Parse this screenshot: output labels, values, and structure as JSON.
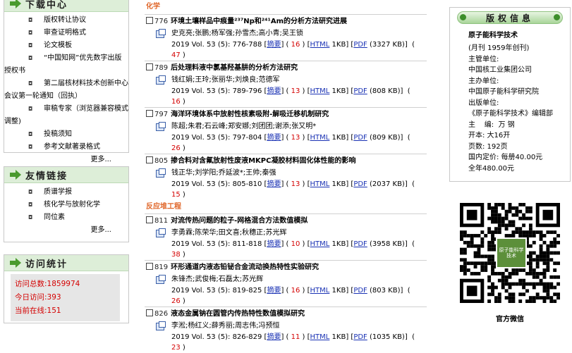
{
  "download_center": {
    "title": "下载中心",
    "items": [
      "版权转让协议",
      "审查证明格式",
      "论文模板",
      "“中国知网”优先数字出版授权书",
      "第二届核材料技术创新中心会议第一轮通知（回执）",
      "审稿专家（浏览器兼容模式调整)",
      "投稿须知",
      "参考文献著录格式"
    ],
    "more": "更多..."
  },
  "friend_links": {
    "title": "友情链接",
    "items": [
      "质谱学报",
      "核化学与放射化学",
      "同位素"
    ],
    "more": "更多..."
  },
  "visit_stats": {
    "title": "访问统计",
    "lines": [
      "访问总数:1859974",
      "今日访问:393",
      "当前在线:151"
    ]
  },
  "sections": [
    {
      "label": "化学",
      "articles": [
        {
          "num": "776",
          "title": "环境土壤样品中痕量²³⁷Np和²⁴¹Am的分析方法研究进展",
          "authors": "史克亮;张鹏;杨军强;孙雪杰;高小青;吴王锁",
          "cite": "2019 Vol. 53 (5): 776-788",
          "abstract_label": "摘要",
          "abstract_count": "16",
          "html_label": "HTML",
          "html_size": "1KB",
          "pdf_label": "PDF",
          "pdf_size": "(3327 KB)",
          "pdf_count": "47"
        },
        {
          "num": "789",
          "title": "后处理料液中氯基羟基肼的分析方法研究",
          "authors": "钱红娟;王玲;张丽华;刘焕良;范德军",
          "cite": "2019 Vol. 53 (5): 789-796",
          "abstract_label": "摘要",
          "abstract_count": "13",
          "html_label": "HTML",
          "html_size": "1KB",
          "pdf_label": "PDF",
          "pdf_size": "(808 KB)",
          "pdf_count": "16"
        },
        {
          "num": "797",
          "title": "海洋环境体系中放射性核素吸附-解吸迁移机制研究",
          "authors": "陈超;朱君;石云峰;郑安娜;刘团团;谢添;张又明*",
          "cite": "2019 Vol. 53 (5): 797-804",
          "abstract_label": "摘要",
          "abstract_count": "13",
          "html_label": "HTML",
          "html_size": "1KB",
          "pdf_label": "PDF",
          "pdf_size": "(809 KB)",
          "pdf_count": "26"
        },
        {
          "num": "805",
          "title": "掺合料对含氟放射性废液MKPC凝胶材料固化体性能的影响",
          "authors": "钱正华;刘学阳;乔延波*;王帅;秦强",
          "cite": "2019 Vol. 53 (5): 805-810",
          "abstract_label": "摘要",
          "abstract_count": "13",
          "html_label": "HTML",
          "html_size": "1KB",
          "pdf_label": "PDF",
          "pdf_size": "(2037 KB)",
          "pdf_count": "15"
        }
      ]
    },
    {
      "label": "反应堆工程",
      "articles": [
        {
          "num": "811",
          "title": "对流传热问题的粒子-网格混合方法数值模拟",
          "authors": "李勇霖;陈荣华;田文喜;秋穗正;苏光辉",
          "cite": "2019 Vol. 53 (5): 811-818",
          "abstract_label": "摘要",
          "abstract_count": "10",
          "html_label": "HTML",
          "html_size": "1KB",
          "pdf_label": "PDF",
          "pdf_size": "(3958 KB)",
          "pdf_count": "38"
        },
        {
          "num": "819",
          "title": "环形通道内液态铅铋合金流动换热特性实验研究",
          "authors": "朱锋杰;武俊梅;石磊太;苏光辉",
          "cite": "2019 Vol. 53 (5): 819-825",
          "abstract_label": "摘要",
          "abstract_count": "16",
          "html_label": "HTML",
          "html_size": "1KB",
          "pdf_label": "PDF",
          "pdf_size": "(803 KB)",
          "pdf_count": "26"
        },
        {
          "num": "826",
          "title": "液态金属钠在圆管内传热特性数值模拟研究",
          "authors": "李淞;杨红义;薛秀丽;周志伟;冯预恒",
          "cite": "2019 Vol. 53 (5): 826-829",
          "abstract_label": "摘要",
          "abstract_count": "11",
          "html_label": "HTML",
          "html_size": "1KB",
          "pdf_label": "PDF",
          "pdf_size": "(1035 KB)",
          "pdf_count": "23"
        }
      ]
    }
  ],
  "publication_info": {
    "title": "版权信息",
    "name": "原子能科学技术",
    "lines": [
      "(月刊   1959年创刊)",
      "主管单位:",
      "中国核工业集团公司",
      "主办单位:",
      "中国原子能科学研究院",
      "出版单位:",
      "《原子能科学技术》编辑部",
      "主    编:  万 钢",
      "开本: 大16开",
      "页数: 192页",
      "国内定价: 每册40.00元",
      "全年480.00元"
    ]
  },
  "qr": {
    "center_text": "原子能科学技术",
    "caption": "官方微信"
  }
}
